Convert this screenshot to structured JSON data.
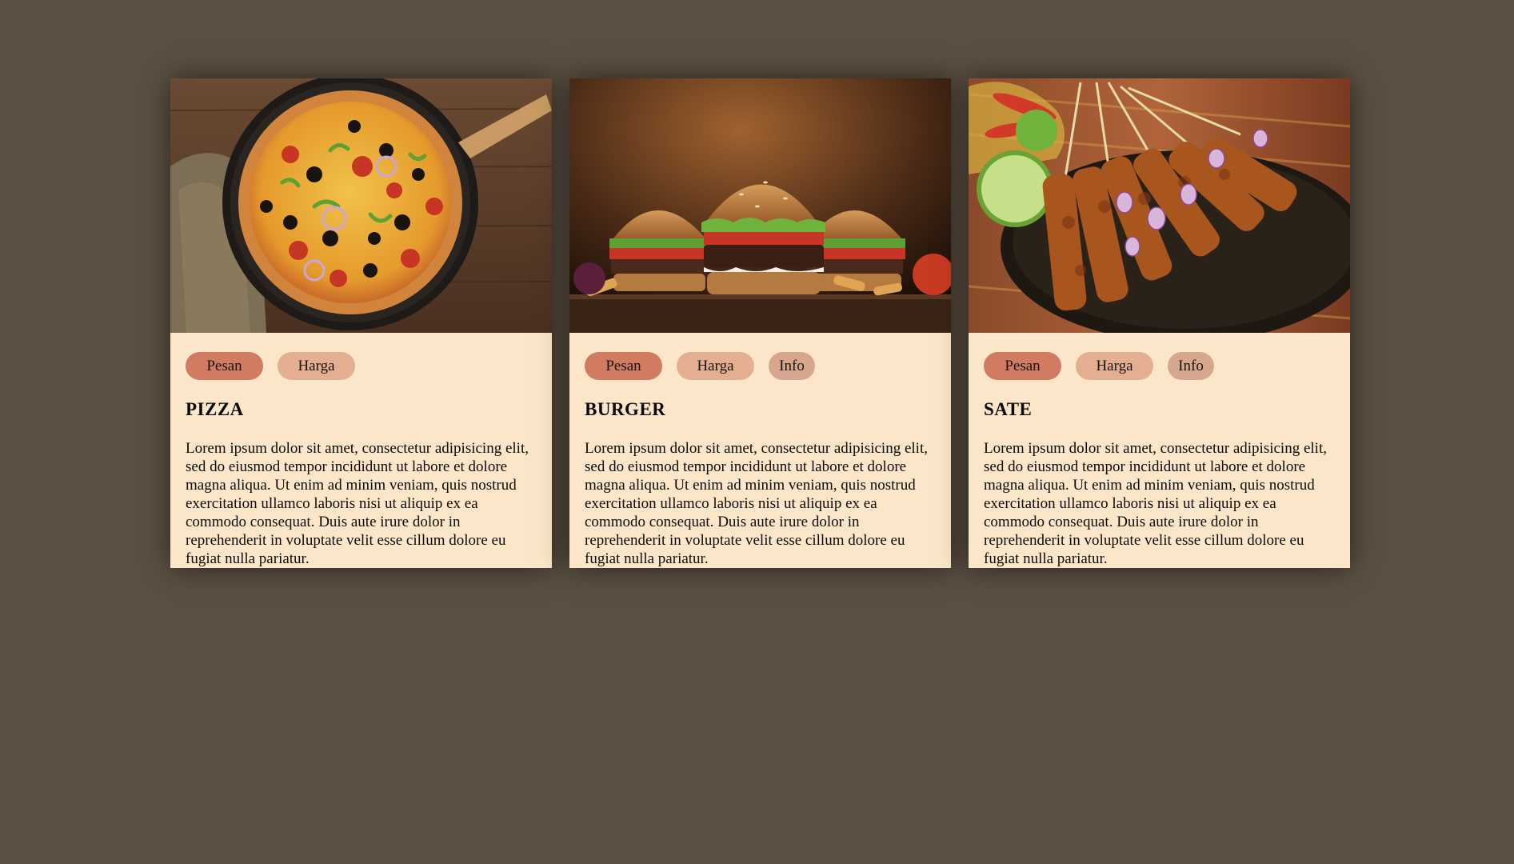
{
  "cards": [
    {
      "image_icon": "pizza-photo",
      "buttons": {
        "order": "Pesan",
        "price": "Harga"
      },
      "title": "PIZZA",
      "text": "Lorem ipsum dolor sit amet, consectetur adipisicing elit, sed do eiusmod tempor incididunt ut labore et dolore magna aliqua. Ut enim ad minim veniam, quis nostrud exercitation ullamco laboris nisi ut aliquip ex ea commodo consequat. Duis aute irure dolor in reprehenderit in voluptate velit esse cillum dolore eu fugiat nulla pariatur."
    },
    {
      "image_icon": "burger-photo",
      "buttons": {
        "order": "Pesan",
        "price": "Harga",
        "info": "Info"
      },
      "title": "BURGER",
      "text": "Lorem ipsum dolor sit amet, consectetur adipisicing elit, sed do eiusmod tempor incididunt ut labore et dolore magna aliqua. Ut enim ad minim veniam, quis nostrud exercitation ullamco laboris nisi ut aliquip ex ea commodo consequat. Duis aute irure dolor in reprehenderit in voluptate velit esse cillum dolore eu fugiat nulla pariatur."
    },
    {
      "image_icon": "sate-photo",
      "buttons": {
        "order": "Pesan",
        "price": "Harga",
        "info": "Info"
      },
      "title": "SATE",
      "text": "Lorem ipsum dolor sit amet, consectetur adipisicing elit, sed do eiusmod tempor incididunt ut labore et dolore magna aliqua. Ut enim ad minim veniam, quis nostrud exercitation ullamco laboris nisi ut aliquip ex ea commodo consequat. Duis aute irure dolor in reprehenderit in voluptate velit esse cillum dolore eu fugiat nulla pariatur."
    }
  ],
  "colors": {
    "page_background": "#5b5042",
    "card_background": "#fce6c9",
    "button_order": "#d07b62",
    "button_price": "#e4ae90",
    "button_info": "#d7a78d"
  }
}
